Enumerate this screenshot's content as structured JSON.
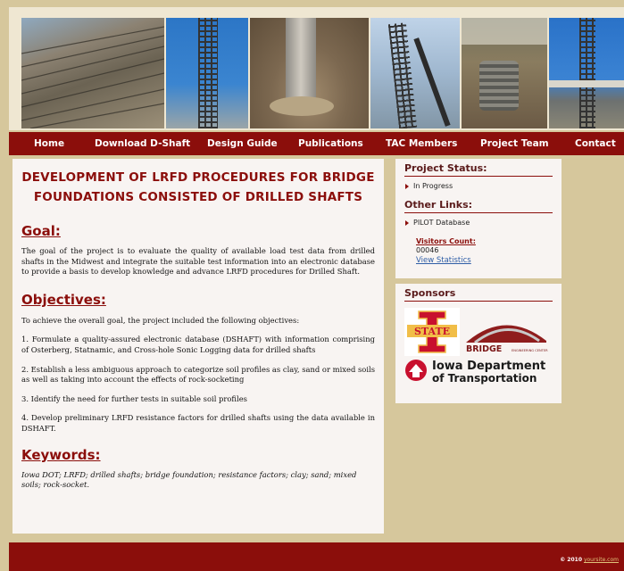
{
  "nav": {
    "items": [
      "Home",
      "Download D-Shaft",
      "Design Guide",
      "Publications",
      "TAC Members",
      "Project Team",
      "Contact"
    ]
  },
  "main": {
    "title_line1": "DEVELOPMENT OF LRFD PROCEDURES FOR BRIDGE",
    "title_line2": "FOUNDATIONS CONSISTED OF DRILLED SHAFTS",
    "goal_heading": "Goal:",
    "goal_text": "The goal of the project is to evaluate the quality of available load test data from drilled shafts in the Midwest and integrate the suitable test information into an electronic database to provide a basis to develop knowledge and advance LRFD procedures for Drilled Shaft.",
    "objectives_heading": "Objectives:",
    "objectives_intro": "To achieve the overall goal, the project included the following objectives:",
    "objectives": [
      "1. Formulate a quality-assured electronic database (DSHAFT) with information comprising of Osterberg, Statnamic, and Cross-hole Sonic Logging data for drilled shafts",
      "2. Establish a less ambiguous approach to categorize soil profiles as clay, sand or mixed soils as well as taking into account the effects of rock-socketing",
      "3. Identify the need for further tests in suitable soil profiles",
      "4. Develop preliminary LRFD resistance factors for drilled shafts using the data available in DSHAFT."
    ],
    "keywords_heading": "Keywords:",
    "keywords_text": "Iowa DOT; LRFD; drilled shafts; bridge foundation; resistance factors; clay; sand; mixed soils; rock-socket."
  },
  "sidebar": {
    "status_heading": "Project Status:",
    "status_item": "In Progress",
    "links_heading": "Other Links:",
    "links_item": "PILOT Database",
    "visitors_label": "Visitors Count:",
    "visitors_count": "00046",
    "view_stats": "View Statistics",
    "sponsors_heading": "Sponsors",
    "logo_state_text": "STATE",
    "logo_bridge_text": "BRIDGE",
    "logo_bridge_sub": "ENGINEERING CENTER",
    "logo_dot_line1": "Iowa Department",
    "logo_dot_line2": "of Transportation"
  },
  "footer": {
    "copyright": "© 2010",
    "site": "yoursite.com"
  },
  "colors": {
    "accent": "#8b0e0b",
    "page_bg": "#d6c79c",
    "panel_bg": "#f8f4f2",
    "link": "#2e5da6"
  }
}
